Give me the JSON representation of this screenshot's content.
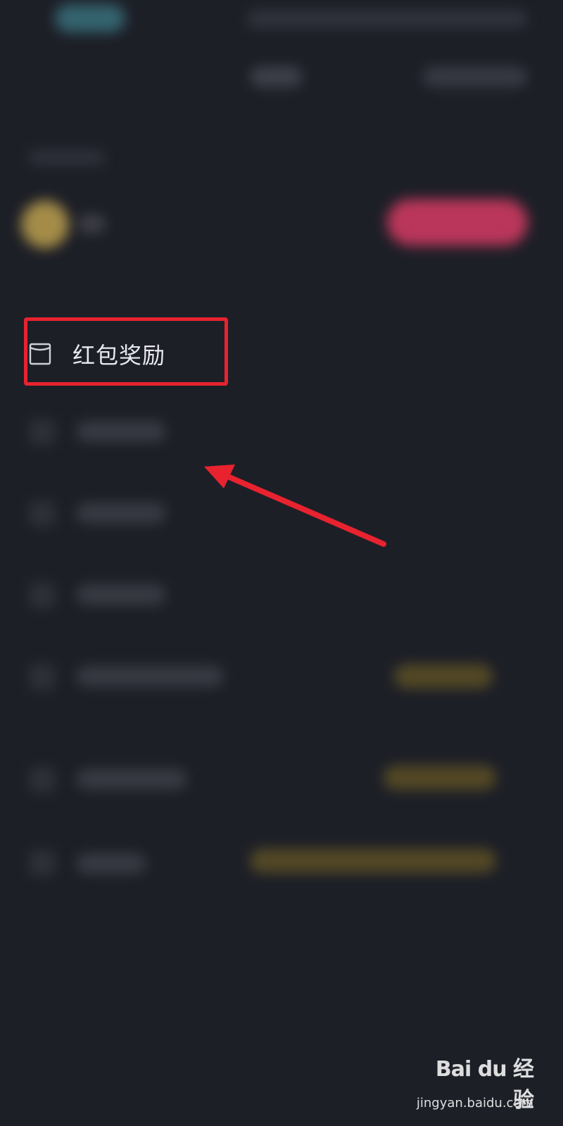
{
  "focused_menu_item": {
    "label": "红包奖励",
    "icon": "red-envelope-icon"
  },
  "annotation": {
    "box_color": "#e8232f",
    "arrow_color": "#e8232f"
  },
  "watermark": {
    "brand": "Bai du 经验",
    "url": "jingyan.baidu.com"
  },
  "colors": {
    "background": "#1d1f27",
    "accent_pink": "#d63b63",
    "accent_gold": "#6b5b24",
    "avatar_gold": "#b3984c"
  }
}
